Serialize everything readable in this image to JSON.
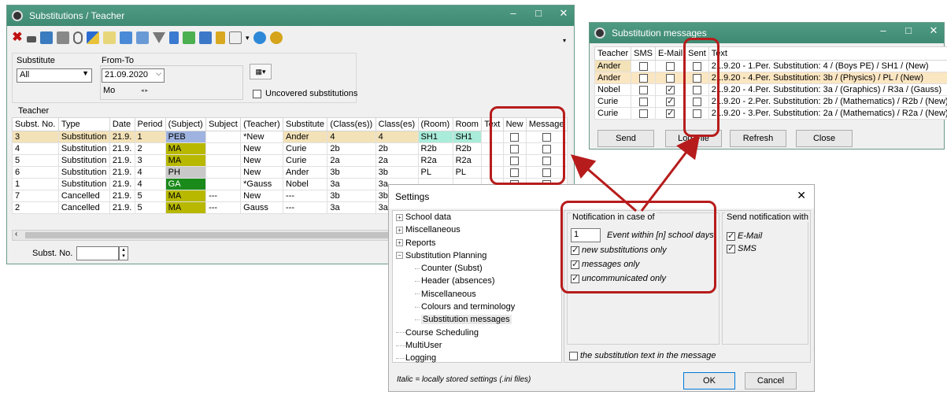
{
  "subst_window": {
    "title": "Substitutions / Teacher",
    "labels": {
      "substitute": "Substitute",
      "from_to": "From-To",
      "teacher": "Teacher",
      "uncovered": "Uncovered substitutions",
      "subst_no": "Subst. No."
    },
    "substitute_value": "All",
    "date_value": "21.09.2020",
    "weekday": "Mo",
    "columns": [
      "Subst. No.",
      "Type",
      "Date",
      "Period",
      "(Subject)",
      "Subject",
      "(Teacher)",
      "Substitute",
      "(Class(es))",
      "Class(es)",
      "(Room)",
      "Room",
      "Text",
      "New",
      "Message"
    ],
    "rows": [
      {
        "no": "3",
        "type": "Substitution",
        "date": "21.9.",
        "period": "1",
        "psubj": "PEB",
        "subj": "",
        "pteacher": "*New",
        "subst": "Ander",
        "pclass": "4",
        "class": "4",
        "proom": "SH1",
        "room": "SH1"
      },
      {
        "no": "4",
        "type": "Substitution",
        "date": "21.9.",
        "period": "2",
        "psubj": "MA",
        "subj": "",
        "pteacher": "New",
        "subst": "Curie",
        "pclass": "2b",
        "class": "2b",
        "proom": "R2b",
        "room": "R2b"
      },
      {
        "no": "5",
        "type": "Substitution",
        "date": "21.9.",
        "period": "3",
        "psubj": "MA",
        "subj": "",
        "pteacher": "New",
        "subst": "Curie",
        "pclass": "2a",
        "class": "2a",
        "proom": "R2a",
        "room": "R2a"
      },
      {
        "no": "6",
        "type": "Substitution",
        "date": "21.9.",
        "period": "4",
        "psubj": "PH",
        "subj": "",
        "pteacher": "New",
        "subst": "Ander",
        "pclass": "3b",
        "class": "3b",
        "proom": "PL",
        "room": "PL"
      },
      {
        "no": "1",
        "type": "Substitution",
        "date": "21.9.",
        "period": "4",
        "psubj": "GA",
        "subj": "",
        "pteacher": "*Gauss",
        "subst": "Nobel",
        "pclass": "3a",
        "class": "3a",
        "proom": "",
        "room": ""
      },
      {
        "no": "7",
        "type": "Cancelled",
        "date": "21.9.",
        "period": "5",
        "psubj": "MA",
        "subj": "---",
        "pteacher": "New",
        "subst": "---",
        "pclass": "3b",
        "class": "3b",
        "proom": "",
        "room": ""
      },
      {
        "no": "2",
        "type": "Cancelled",
        "date": "21.9.",
        "period": "5",
        "psubj": "MA",
        "subj": "---",
        "pteacher": "Gauss",
        "subst": "---",
        "pclass": "3a",
        "class": "3a",
        "proom": "",
        "room": ""
      }
    ],
    "subject_colors": {
      "PEB": "#9fb3e0",
      "MA": "#b8b800",
      "PH": "#c8c8c8",
      "GA": "#1a8a1a"
    }
  },
  "msg_window": {
    "title": "Substitution messages",
    "columns": [
      "Teacher",
      "SMS",
      "E-Mail",
      "Sent",
      "Text"
    ],
    "rows": [
      {
        "teacher": "Ander",
        "sms": false,
        "email": false,
        "sent": false,
        "text": "21.9.20 - 1.Per. Substitution: 4 / (Boys PE) / SH1 / (New)"
      },
      {
        "teacher": "Ander",
        "sms": false,
        "email": false,
        "sent": false,
        "text": "21.9.20 - 4.Per. Substitution: 3b / (Physics) / PL / (New)"
      },
      {
        "teacher": "Nobel",
        "sms": false,
        "email": true,
        "sent": false,
        "text": "21.9.20 - 4.Per. Substitution: 3a / (Graphics) / R3a / (Gauss)"
      },
      {
        "teacher": "Curie",
        "sms": false,
        "email": true,
        "sent": false,
        "text": "21.9.20 - 2.Per. Substitution: 2b / (Mathematics) / R2b / (New)"
      },
      {
        "teacher": "Curie",
        "sms": false,
        "email": true,
        "sent": false,
        "text": "21.9.20 - 3.Per. Substitution: 2a / (Mathematics) / R2a / (New)"
      }
    ],
    "buttons": {
      "send": "Send",
      "logfile": "Log-File",
      "refresh": "Refresh",
      "close": "Close"
    }
  },
  "settings": {
    "title": "Settings",
    "tree": [
      {
        "label": "School data",
        "expander": true,
        "level": 0
      },
      {
        "label": "Miscellaneous",
        "expander": true,
        "level": 0
      },
      {
        "label": "Reports",
        "expander": true,
        "level": 0
      },
      {
        "label": "Substitution Planning",
        "expander": true,
        "expanded": true,
        "level": 0
      },
      {
        "label": "Counter (Subst)",
        "level": 1
      },
      {
        "label": "Header (absences)",
        "level": 1
      },
      {
        "label": "Miscellaneous",
        "level": 1
      },
      {
        "label": "Colours and terminology",
        "level": 1
      },
      {
        "label": "Substitution messages",
        "level": 1,
        "selected": true
      },
      {
        "label": "Course Scheduling",
        "level": 0
      },
      {
        "label": "MultiUser",
        "level": 0
      },
      {
        "label": "Logging",
        "level": 0
      }
    ],
    "notification_group": "Notification in case of",
    "days_value": "1",
    "days_label": "Event within [n] school days",
    "options": [
      {
        "label": "new substitutions only",
        "checked": true
      },
      {
        "label": "messages only",
        "checked": true
      },
      {
        "label": "uncommunicated only",
        "checked": true
      }
    ],
    "send_group": "Send notification with",
    "send_options": [
      {
        "label": "E-Mail",
        "checked": true
      },
      {
        "label": "SMS",
        "checked": true
      }
    ],
    "subst_text_label": "the substitution text in the message",
    "footer_note": "Italic = locally stored settings (.ini files)",
    "ok": "OK",
    "cancel": "Cancel"
  }
}
